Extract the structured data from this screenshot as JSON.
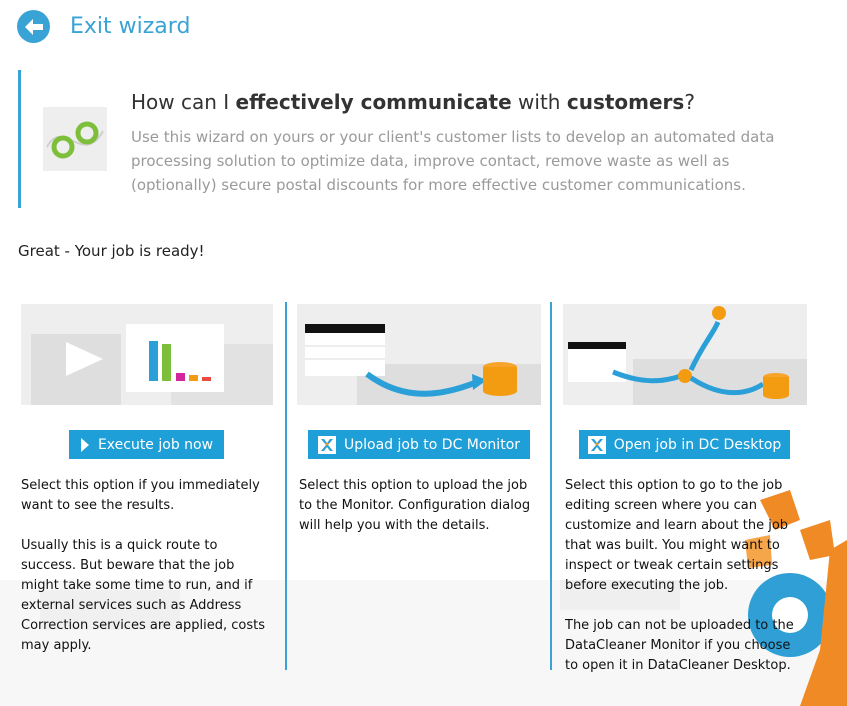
{
  "exit": {
    "label": "Exit wizard"
  },
  "header": {
    "title_parts": [
      "How can I ",
      "effectively communicate",
      " with ",
      "customers",
      "?"
    ],
    "description": "Use this wizard on yours or your client's customer lists to develop an automated data processing solution to optimize data, improve contact, remove waste as well as (optionally) secure postal discounts for more effective customer communications."
  },
  "status": {
    "message": "Great - Your job is ready!"
  },
  "options": [
    {
      "button_label": "Execute job now",
      "paragraphs": [
        "Select this option if you immediately want to see the results.",
        "Usually this is a quick route to success. But beware that the job might take some time to run, and if external services such as Address Correction services are applied, costs may apply."
      ]
    },
    {
      "button_label": "Upload job to DC Monitor",
      "paragraphs": [
        "Select this option to upload the job to the Monitor. Configuration dialog will help you with the details."
      ]
    },
    {
      "button_label": "Open job in DC Desktop",
      "paragraphs": [
        "Select this option to go to the job editing screen where you can customize and learn about the job that was built. You might want to inspect or tweak certain settings before executing the job.",
        "The job can not be uploaded to the DataCleaner Monitor if you choose to open it in DataCleaner Desktop."
      ]
    }
  ],
  "colors": {
    "accent": "#3aa3d6",
    "button": "#1f9fd8",
    "orange": "#f39c12",
    "green": "#7dbf3b"
  }
}
